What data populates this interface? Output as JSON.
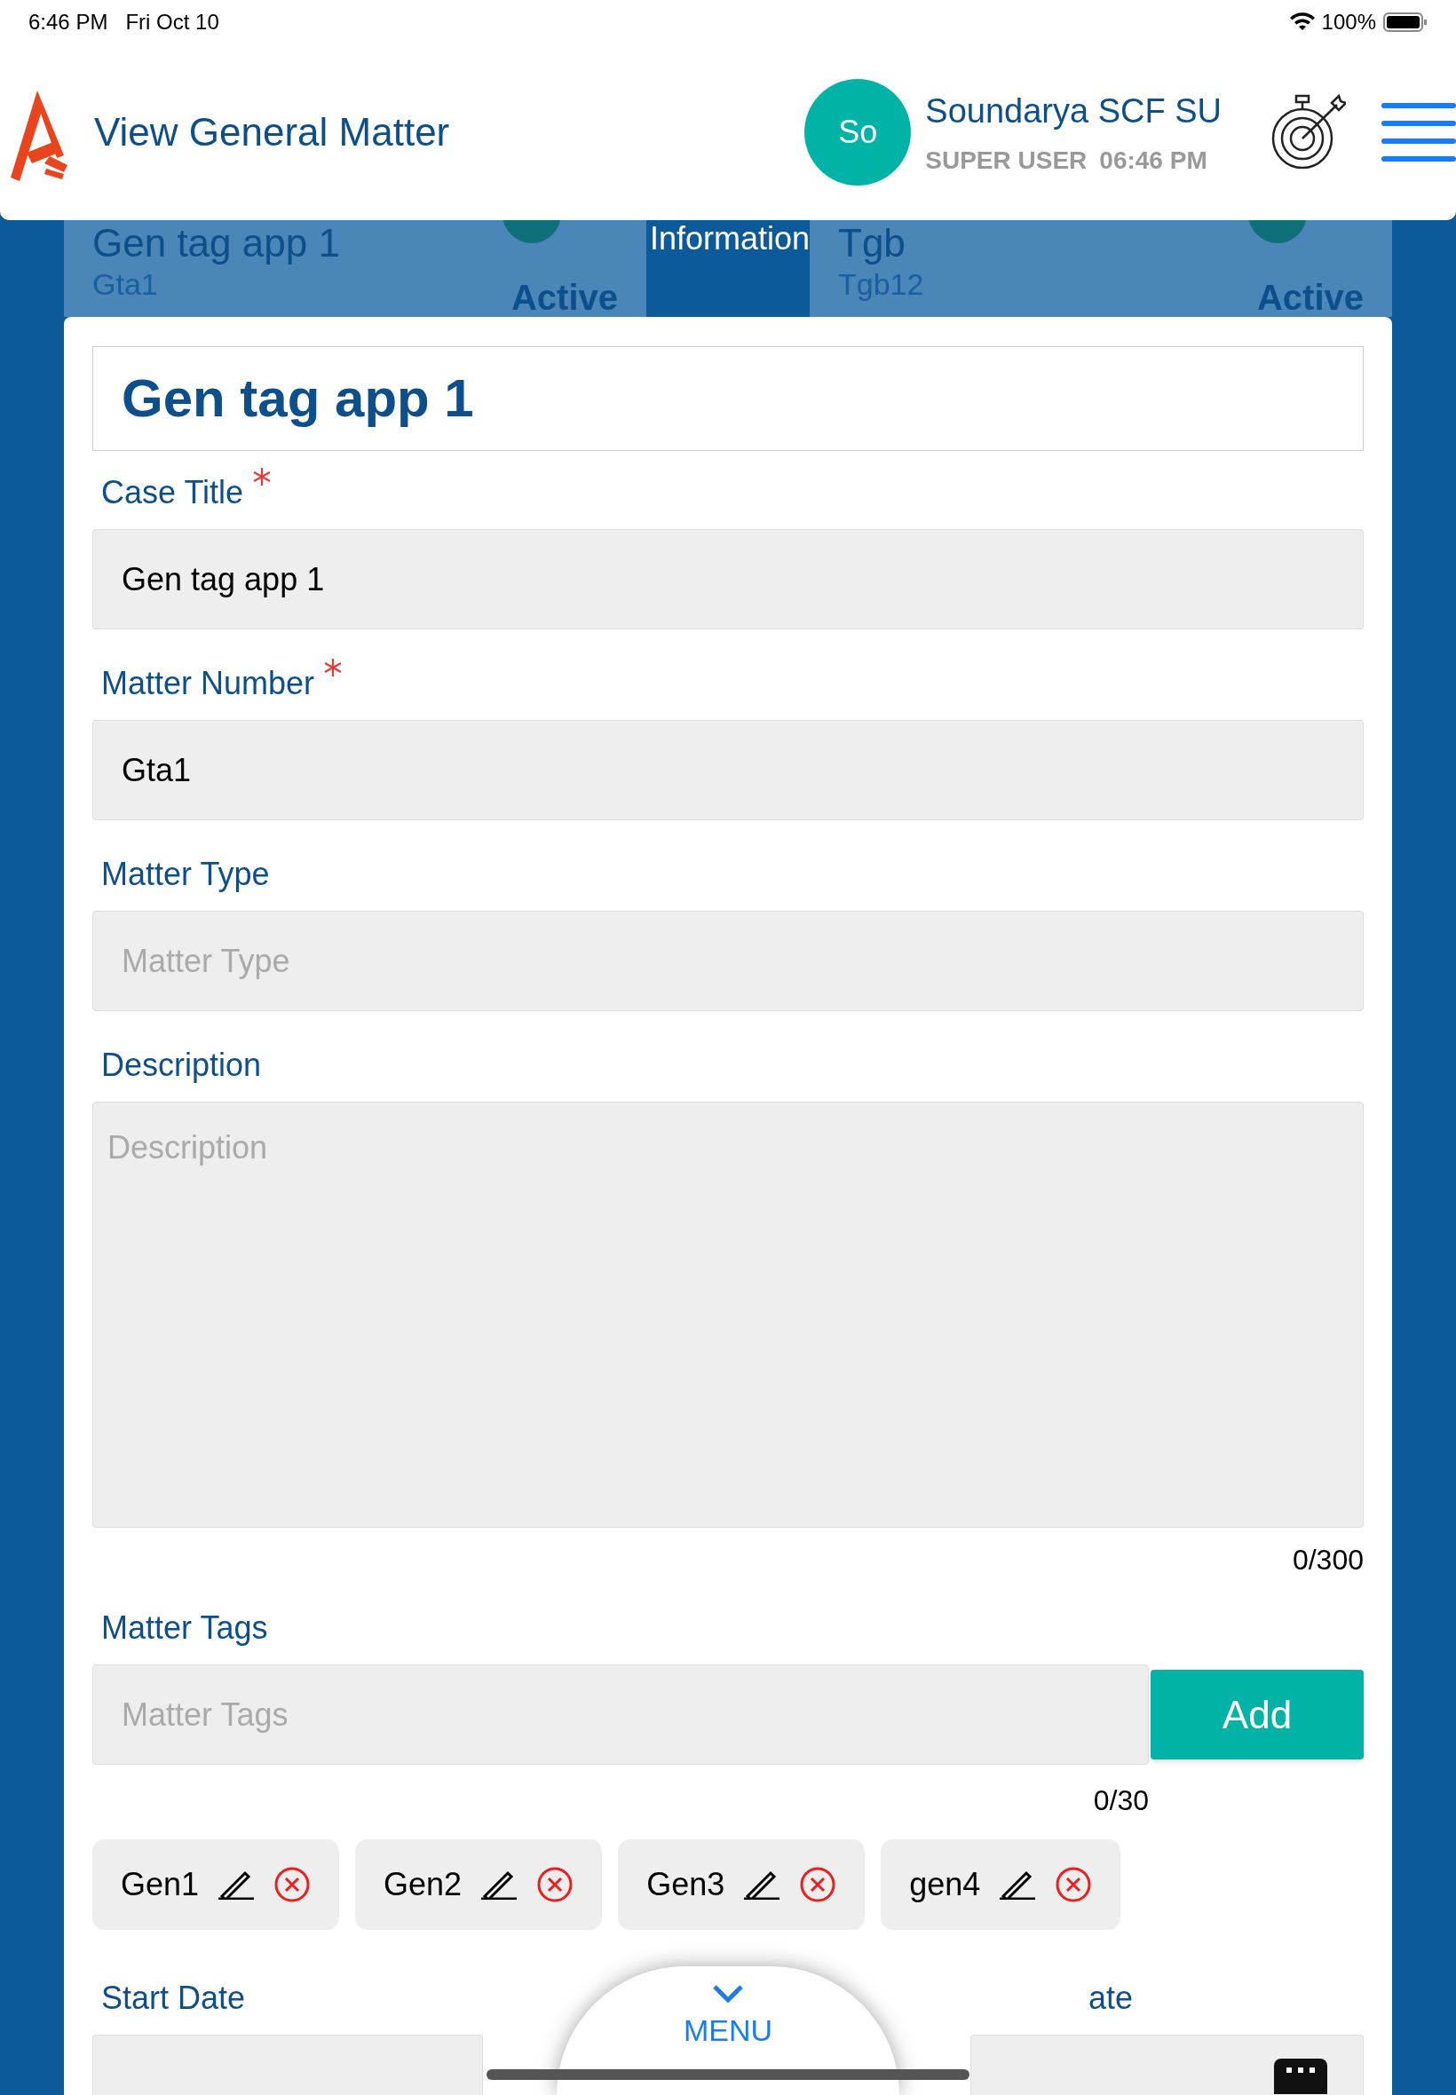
{
  "status_bar": {
    "time": "6:46 PM",
    "date": "Fri Oct 10",
    "battery": "100%"
  },
  "header": {
    "title": "View General Matter",
    "avatar": "So",
    "user_name": "Soundarya SCF SU",
    "role": "SUPER USER",
    "time": "06:46 PM"
  },
  "background_cards": [
    {
      "title": "Gen tag app 1",
      "number": "Gta1",
      "status": "Active"
    },
    {
      "title": "Tgb",
      "number": "Tgb12",
      "status": "Active"
    }
  ],
  "section_label": "Information",
  "form": {
    "heading": "Gen tag app 1",
    "fields": [
      {
        "label": "Case Title",
        "required": true,
        "value": "Gen tag app 1"
      },
      {
        "label": "Matter Number",
        "required": true,
        "value": "Gta1"
      },
      {
        "label": "Matter Type",
        "required": false,
        "placeholder": "Matter Type"
      }
    ],
    "description": {
      "label": "Description",
      "placeholder": "Description",
      "counter": "0/300"
    },
    "tags": {
      "label": "Matter Tags",
      "placeholder": "Matter Tags",
      "button": "Add",
      "counter": "0/30",
      "items": [
        "Gen1",
        "Gen2",
        "Gen3",
        "gen4"
      ]
    },
    "start_date": {
      "label": "Start Date"
    },
    "end_date": {
      "label": "ate"
    }
  },
  "menu_button": "MENU"
}
